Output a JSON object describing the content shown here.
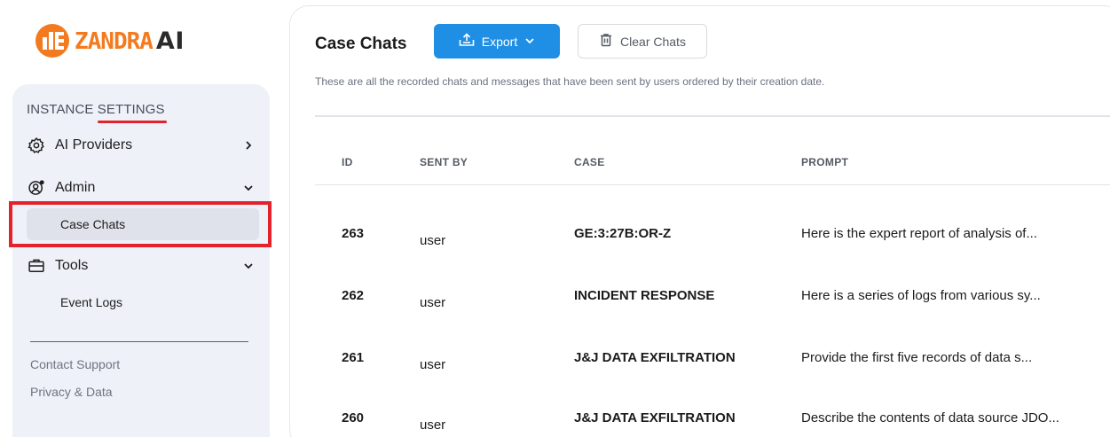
{
  "brand": {
    "name": "ZANDRA",
    "suffix": "AI",
    "color": "#f37a1f"
  },
  "sidebar": {
    "section_title": "INSTANCE SETTINGS",
    "items": [
      {
        "label": "AI Providers",
        "icon": "gear-icon",
        "chevron": "chevron-right-icon"
      },
      {
        "label": "Admin",
        "icon": "user-gear-icon",
        "chevron": "chevron-down-icon"
      },
      {
        "label": "Case Chats",
        "active": true
      },
      {
        "label": "Tools",
        "icon": "briefcase-icon",
        "chevron": "chevron-down-icon"
      },
      {
        "label": "Event Logs"
      }
    ],
    "footer": [
      "Contact Support",
      "Privacy & Data"
    ]
  },
  "main": {
    "title": "Case Chats",
    "export_label": "Export",
    "clear_label": "Clear Chats",
    "description": "These are all the recorded chats and messages that have been sent by users ordered by their creation date.",
    "columns": [
      "ID",
      "SENT BY",
      "CASE",
      "PROMPT"
    ],
    "rows": [
      {
        "id": "263",
        "sent_by": "user",
        "case": "GE:3:27B:OR-Z",
        "prompt": "Here is the expert report of analysis of..."
      },
      {
        "id": "262",
        "sent_by": "user",
        "case": "INCIDENT RESPONSE",
        "prompt": "Here is a series of logs from various sy..."
      },
      {
        "id": "261",
        "sent_by": "user",
        "case": "J&J DATA EXFILTRATION",
        "prompt": "Provide the first five records of data s..."
      },
      {
        "id": "260",
        "sent_by": "user",
        "case": "J&J DATA EXFILTRATION",
        "prompt": "Describe the contents of data source JDO..."
      }
    ]
  },
  "colors": {
    "accent": "#1f8fe5",
    "highlight": "#e3222b",
    "sidebar_bg": "#eef1f8"
  }
}
